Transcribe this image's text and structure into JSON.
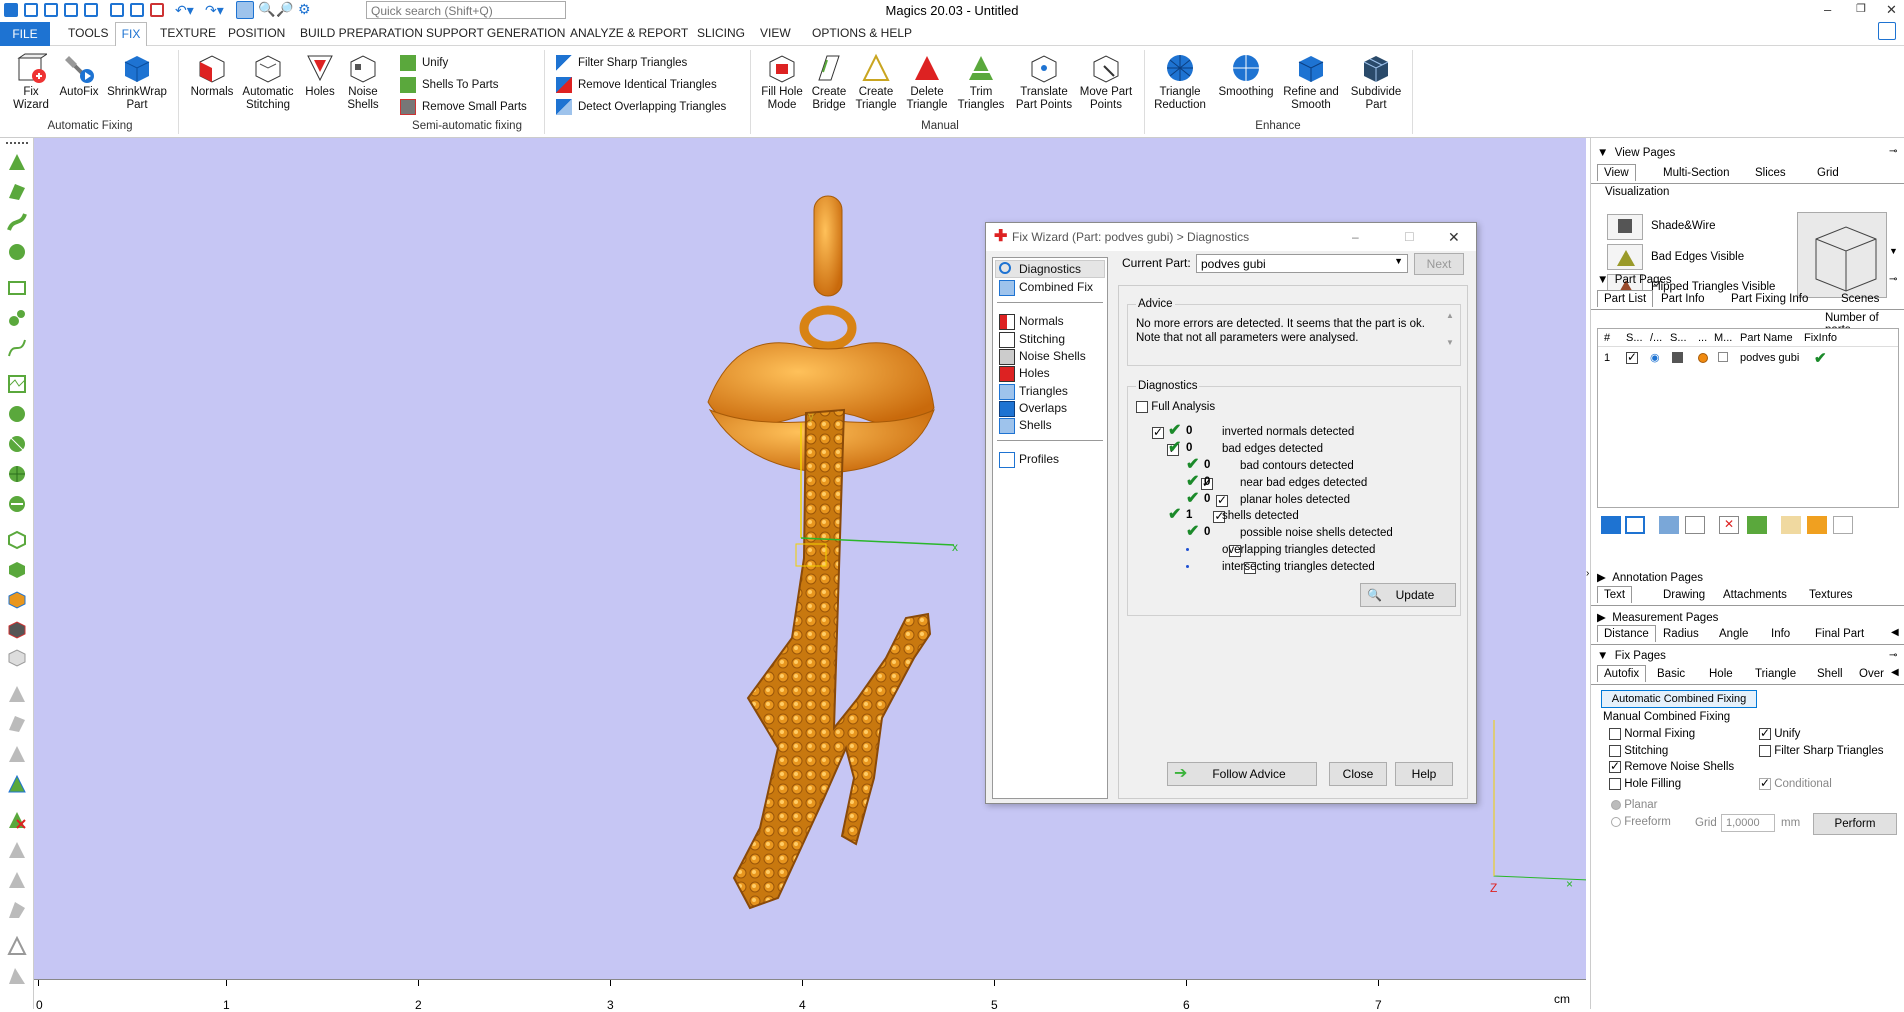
{
  "app": {
    "title": "Magics 20.03 - Untitled",
    "quick_search_placeholder": "Quick search (Shift+Q)"
  },
  "menu": {
    "file": "FILE",
    "tabs": [
      "TOOLS",
      "FIX",
      "TEXTURE",
      "POSITION",
      "BUILD PREPARATION",
      "SUPPORT GENERATION",
      "ANALYZE & REPORT",
      "SLICING",
      "VIEW",
      "OPTIONS & HELP"
    ]
  },
  "ribbon": {
    "auto_fixing": {
      "label": "Automatic Fixing",
      "fix_wizard": "Fix\nWizard",
      "autofix": "AutoFix",
      "shrinkwrap": "ShrinkWrap\nPart"
    },
    "semi": {
      "label": "Semi-automatic fixing",
      "normals": "Normals",
      "auto_stitch": "Automatic\nStitching",
      "holes": "Holes",
      "noise_shells": "Noise\nShells",
      "unify": "Unify",
      "shells_to_parts": "Shells To Parts",
      "remove_small_parts": "Remove Small Parts",
      "filter_sharp": "Filter Sharp Triangles",
      "remove_identical": "Remove Identical Triangles",
      "detect_overlap": "Detect Overlapping Triangles"
    },
    "manual": {
      "label": "Manual",
      "fill_hole_mode": "Fill Hole\nMode",
      "create_bridge": "Create\nBridge",
      "create_triangle": "Create\nTriangle",
      "delete_triangle": "Delete\nTriangle",
      "trim_triangles": "Trim\nTriangles",
      "translate_part_points": "Translate\nPart Points",
      "move_part_points": "Move Part\nPoints"
    },
    "enhance": {
      "label": "Enhance",
      "triangle_reduction": "Triangle\nReduction",
      "smoothing": "Smoothing",
      "refine_smooth": "Refine and\nSmooth",
      "subdivide": "Subdivide\nPart"
    }
  },
  "viewport": {
    "axis_y": "y",
    "axis_x": "x",
    "axis_z": "Z"
  },
  "ruler": {
    "unit": "cm",
    "ticks": [
      "0",
      "1",
      "2",
      "3",
      "4",
      "5",
      "6",
      "7"
    ]
  },
  "dialog": {
    "title": "Fix Wizard (Part: podves gubi) > Diagnostics",
    "nav": [
      "Diagnostics",
      "Combined Fix",
      "Normals",
      "Stitching",
      "Noise Shells",
      "Holes",
      "Triangles",
      "Overlaps",
      "Shells",
      "Profiles"
    ],
    "current_part_label": "Current Part:",
    "current_part": "podves gubi",
    "next": "Next",
    "advice_label": "Advice",
    "advice_text": "No more errors are detected. It seems that the part is ok.\nNote that not all parameters were analysed.",
    "diagnostics_label": "Diagnostics",
    "full_analysis": "Full Analysis",
    "rows": [
      {
        "count": "0",
        "label": "inverted normals detected"
      },
      {
        "count": "0",
        "label": "bad edges detected"
      },
      {
        "count": "0",
        "label": "bad contours detected"
      },
      {
        "count": "0",
        "label": "near bad edges detected"
      },
      {
        "count": "0",
        "label": "planar holes detected"
      },
      {
        "count": "1",
        "label": "shells detected"
      },
      {
        "count": "0",
        "label": "possible noise shells detected"
      },
      {
        "count": "",
        "label": "overlapping triangles detected"
      },
      {
        "count": "",
        "label": "intersecting triangles detected"
      }
    ],
    "update": "Update",
    "follow_advice": "Follow Advice",
    "close": "Close",
    "help": "Help"
  },
  "right": {
    "view_pages": "View Pages",
    "view_tabs": [
      "View",
      "Multi-Section",
      "Slices",
      "Grid"
    ],
    "visualization": "Visualization",
    "vis_items": [
      "Shade&Wire",
      "Bad Edges Visible",
      "Flipped Triangles Visible"
    ],
    "part_pages": "Part Pages",
    "part_tabs": [
      "Part List",
      "Part Info",
      "Part Fixing Info",
      "Scenes"
    ],
    "number_of_parts": "Number of parts",
    "part_cols": [
      "#",
      "S...",
      "/...",
      "S...",
      "...",
      "M...",
      "Part Name",
      "FixInfo"
    ],
    "part_row": {
      "index": "1",
      "name": "podves gubi"
    },
    "annotation_pages": "Annotation Pages",
    "annotation_tabs": [
      "Text",
      "Drawing",
      "Attachments",
      "Textures"
    ],
    "measurement_pages": "Measurement Pages",
    "measurement_tabs": [
      "Distance",
      "Radius",
      "Angle",
      "Info",
      "Final Part"
    ],
    "fix_pages": "Fix Pages",
    "fix_tabs": [
      "Autofix",
      "Basic",
      "Hole",
      "Triangle",
      "Shell",
      "Over"
    ],
    "auto_combined": "Automatic Combined Fixing",
    "manual_combined": "Manual Combined Fixing",
    "normal_fixing": "Normal Fixing",
    "unify": "Unify",
    "stitching": "Stitching",
    "filter_sharp": "Filter Sharp Triangles",
    "remove_noise": "Remove Noise Shells",
    "hole_filling": "Hole Filling",
    "conditional": "Conditional",
    "planar": "Planar",
    "freeform": "Freeform",
    "grid": "Grid",
    "grid_value": "1,0000",
    "mm": "mm",
    "perform": "Perform"
  },
  "colors": {
    "accent": "#1e73d2",
    "viewport_bg": "#c6c6f4",
    "part": "#e8961e",
    "check_green": "#1b8a2a"
  }
}
